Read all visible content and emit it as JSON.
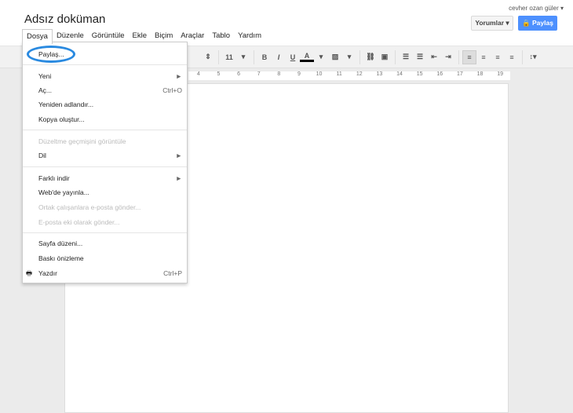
{
  "title": "Adsız doküman",
  "user": "cevher ozan güler ▾",
  "comments_button": "Yorumlar ▾",
  "share_button": "Paylaş",
  "menubar": [
    "Dosya",
    "Düzenle",
    "Görüntüle",
    "Ekle",
    "Biçim",
    "Araçlar",
    "Tablo",
    "Yardım"
  ],
  "toolbar": {
    "font_size": "11",
    "bold": "B",
    "italic": "I",
    "underline": "U",
    "text_color": "A"
  },
  "ruler": [
    "4",
    "5",
    "6",
    "7",
    "8",
    "9",
    "10",
    "11",
    "12",
    "13",
    "14",
    "15",
    "16",
    "17",
    "18",
    "19"
  ],
  "accent": "#4d90fe",
  "file_menu": [
    {
      "label": "Paylaş...",
      "shortcut": "",
      "disabled": false
    },
    {
      "label": "Yeni",
      "shortcut": "►",
      "disabled": false
    },
    {
      "label": "Aç...",
      "shortcut": "Ctrl+O",
      "disabled": false
    },
    {
      "label": "Yeniden adlandır...",
      "shortcut": "",
      "disabled": false
    },
    {
      "label": "Kopya oluştur...",
      "shortcut": "",
      "disabled": false
    },
    {
      "label": "Düzeltme geçmişini görüntüle",
      "shortcut": "",
      "disabled": true
    },
    {
      "label": "Dil",
      "shortcut": "►",
      "disabled": false
    },
    {
      "label": "Farklı indir",
      "shortcut": "►",
      "disabled": false
    },
    {
      "label": "Web'de yayınla...",
      "shortcut": "",
      "disabled": false
    },
    {
      "label": "Ortak çalışanlara e-posta gönder...",
      "shortcut": "",
      "disabled": true
    },
    {
      "label": "E-posta eki olarak gönder...",
      "shortcut": "",
      "disabled": true
    },
    {
      "label": "Sayfa düzeni...",
      "shortcut": "",
      "disabled": false
    },
    {
      "label": "Baskı önizleme",
      "shortcut": "",
      "disabled": false
    },
    {
      "label": "Yazdır",
      "shortcut": "Ctrl+P",
      "disabled": false
    }
  ]
}
